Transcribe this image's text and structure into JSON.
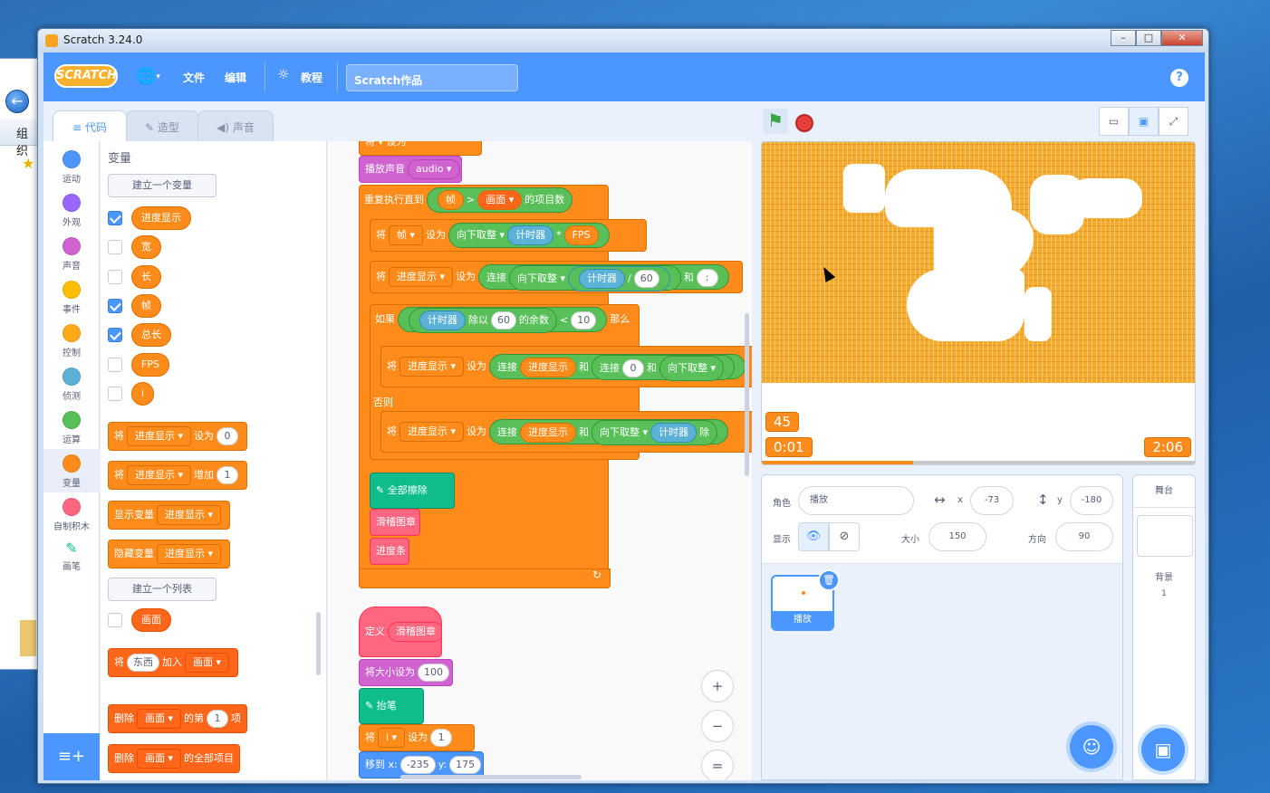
{
  "window": {
    "title": "Scratch 3.24.0",
    "controls": [
      "–",
      "□",
      "✕"
    ]
  },
  "desktop": {
    "back_glyph": "←",
    "toolbar_label": "组织",
    "fav_glyph": "★"
  },
  "menubar": {
    "logo": "SCRATCH",
    "globe_glyph": "🌐",
    "caret": "▾",
    "file": "文件",
    "edit": "编辑",
    "tutorials": "教程",
    "project_title": "Scratch作品",
    "help": "?"
  },
  "tabs": {
    "code": "代码",
    "costumes": "造型",
    "sounds": "声音"
  },
  "categories": [
    {
      "label": "运动",
      "color": "#4c97ff"
    },
    {
      "label": "外观",
      "color": "#9966ff"
    },
    {
      "label": "声音",
      "color": "#cf63cf"
    },
    {
      "label": "事件",
      "color": "#ffbf00"
    },
    {
      "label": "控制",
      "color": "#ffab19"
    },
    {
      "label": "侦测",
      "color": "#5cb1d6"
    },
    {
      "label": "运算",
      "color": "#59c059"
    },
    {
      "label": "变量",
      "color": "#ff8c1a"
    },
    {
      "label": "自制积木",
      "color": "#ff6680"
    },
    {
      "label": "画笔",
      "color": "#0fbd8c"
    }
  ],
  "palette": {
    "title": "变量",
    "make_variable": "建立一个变量",
    "variables": [
      {
        "name": "进度显示",
        "checked": true
      },
      {
        "name": "宽",
        "checked": false
      },
      {
        "name": "长",
        "checked": false
      },
      {
        "name": "帧",
        "checked": true
      },
      {
        "name": "总长",
        "checked": true
      },
      {
        "name": "FPS",
        "checked": false
      },
      {
        "name": "i",
        "checked": false
      }
    ],
    "set_block": {
      "label": "将",
      "var": "进度显示",
      "verb": "设为",
      "value": "0"
    },
    "change_block": {
      "label": "将",
      "var": "进度显示",
      "verb": "增加",
      "value": "1"
    },
    "show_block": {
      "label": "显示变量",
      "var": "进度显示"
    },
    "hide_block": {
      "label": "隐藏变量",
      "var": "进度显示"
    },
    "make_list": "建立一个列表",
    "list_name": "画面",
    "add_block": {
      "label": "将",
      "item": "东西",
      "verb": "加入",
      "list": "画面"
    },
    "delete_block": {
      "label": "删除",
      "list": "画面",
      "mid": "的第",
      "index": "1",
      "end": "项"
    },
    "delete_all_block": {
      "label": "删除",
      "list": "画面",
      "end": "的全部项目"
    }
  },
  "script": {
    "top_partial": {
      "l1": "将",
      "l2": "设为"
    },
    "play_sound": {
      "label": "播放声音",
      "sound": "audio"
    },
    "repeat_until": {
      "label": "重复执行直到",
      "var": "帧",
      "op": ">",
      "list": "画面",
      "tail": "的项目数"
    },
    "set_frame": {
      "label": "将",
      "var": "帧",
      "verb": "设为",
      "floor": "向下取整",
      "timer": "计时器",
      "op": "*",
      "fps": "FPS"
    },
    "set_progress": {
      "label": "将",
      "var": "进度显示",
      "verb": "设为",
      "join": "连接",
      "floor": "向下取整",
      "timer": "计时器",
      "op": "/",
      "num": "60",
      "and": "和",
      "colon": ":"
    },
    "if_block": {
      "label": "如果",
      "timer": "计时器",
      "mod": "除以",
      "num": "60",
      "tail": "的余数",
      "op": "<",
      "num2": "10",
      "then": "那么"
    },
    "if_set": {
      "label": "将",
      "var": "进度显示",
      "verb": "设为",
      "join": "连接",
      "var2": "进度显示",
      "and": "和",
      "join2": "连接",
      "zero": "0",
      "and2": "和",
      "floor": "向下取整"
    },
    "else": "否则",
    "else_set": {
      "label": "将",
      "var": "进度显示",
      "verb": "设为",
      "join": "连接",
      "var2": "进度显示",
      "and": "和",
      "floor": "向下取整",
      "timer": "计时器",
      "tail": "除"
    },
    "clear": "全部擦除",
    "custom1": "滑稽图章",
    "custom2": "进度条",
    "loop_arrow": "↻",
    "define": {
      "label": "定义",
      "name": "滑稽图章"
    },
    "set_size": {
      "label": "将大小设为",
      "value": "100"
    },
    "pen_up": "抬笔",
    "set_i": {
      "label": "将",
      "var": "i",
      "verb": "设为",
      "value": "1"
    },
    "goto": {
      "label": "移到 x:",
      "x": "-235",
      "ylabel": "y:",
      "y": "175"
    },
    "zoom_in": "+",
    "zoom_out": "−",
    "zoom_reset": "="
  },
  "stage": {
    "flag_glyph": "⚑",
    "view_glyphs": [
      "▭",
      "▣",
      "⤢"
    ],
    "monitors": {
      "frame": "45",
      "progress": "0:01",
      "total": "2:06"
    },
    "progress_percent": 35
  },
  "sprite_info": {
    "sprite_label": "角色",
    "sprite_name": "播放",
    "x_label": "x",
    "x": "-73",
    "y_label": "y",
    "y": "-180",
    "show_label": "显示",
    "size_label": "大小",
    "size": "150",
    "direction_label": "方向",
    "direction": "90",
    "eye_glyphs": [
      "👁",
      "⊘"
    ],
    "arrow_h": "↔",
    "arrow_v": "↕"
  },
  "sprites": [
    {
      "name": "播放"
    }
  ],
  "stage_panel": {
    "title": "舞台",
    "backdrops_label": "背景",
    "backdrop_count": "1"
  }
}
